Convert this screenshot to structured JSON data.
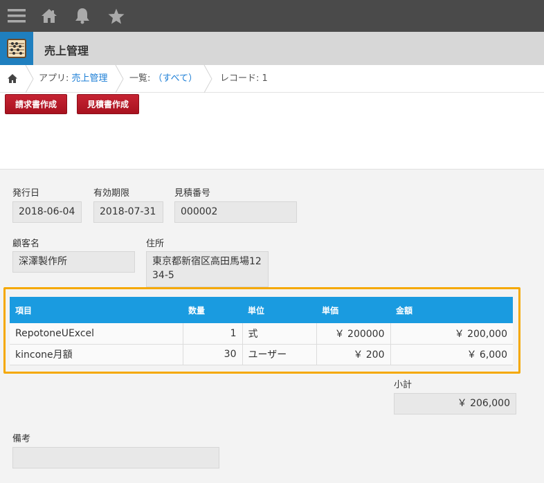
{
  "topbar": {
    "icons": [
      "menu-icon",
      "home-icon",
      "bell-icon",
      "star-icon"
    ]
  },
  "app": {
    "title": "売上管理",
    "icon": "abacus-icon"
  },
  "breadcrumb": {
    "app_prefix": "アプリ: ",
    "app_name": "売上管理",
    "list_prefix": "一覧: ",
    "list_name": "（すべて）",
    "record": "レコード: 1"
  },
  "actions": {
    "invoice_label": "請求書作成",
    "quote_label": "見積書作成"
  },
  "form": {
    "issue_date_label": "発行日",
    "issue_date": "2018-06-04",
    "expiry_label": "有効期限",
    "expiry": "2018-07-31",
    "quote_no_label": "見積番号",
    "quote_no": "000002",
    "customer_label": "顧客名",
    "customer": "深澤製作所",
    "address_label": "住所",
    "address": "東京都新宿区高田馬場1234-5",
    "subtotal_label": "小計",
    "subtotal": "￥ 206,000",
    "notes_label": "備考",
    "notes": ""
  },
  "table": {
    "headers": [
      "項目",
      "数量",
      "単位",
      "単価",
      "金額"
    ],
    "rows": [
      [
        "RepotoneUExcel",
        "1",
        "式",
        "￥ 200000",
        "￥ 200,000"
      ],
      [
        "kincone月額",
        "30",
        "ユーザー",
        "￥ 200",
        "￥ 6,000"
      ]
    ]
  },
  "colors": {
    "topbar": "#4a4a4a",
    "header": "#d7d7d7",
    "accent_blue": "#1a9be0",
    "highlight": "#f5a800",
    "button_red": "#b81b29"
  }
}
